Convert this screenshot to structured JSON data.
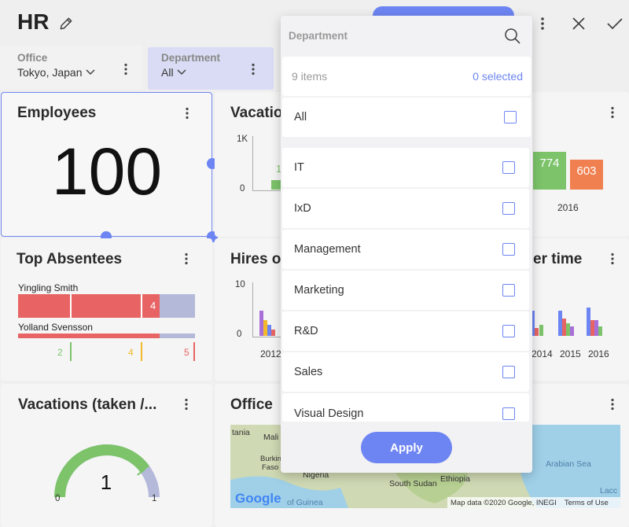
{
  "header": {
    "title": "HR"
  },
  "filters": {
    "office": {
      "label": "Office",
      "value": "Tokyo, Japan"
    },
    "department": {
      "label": "Department",
      "value": "All"
    }
  },
  "cards": {
    "employees": {
      "title": "Employees",
      "value": "100"
    },
    "vacations": {
      "title": "Vacatio",
      "y_ticks": [
        "1K",
        "0"
      ],
      "bar_label_a": "774",
      "bar_label_b": "603",
      "bar_label_partial": "1",
      "year": "2016"
    },
    "top_absentees": {
      "title": "Top Absentees",
      "rows": [
        {
          "name": "Yingling Smith",
          "badge": "4"
        },
        {
          "name": "Yolland Svensson"
        }
      ],
      "markers": [
        "2",
        "4",
        "5"
      ]
    },
    "hires": {
      "title": "Hires ov",
      "y_ticks": [
        "10",
        "0"
      ],
      "x_start": "2012"
    },
    "over_time": {
      "title": "er time",
      "years": [
        "2014",
        "2015",
        "2016"
      ]
    },
    "vacations_taken": {
      "title": "Vacations (taken /...",
      "value": "1",
      "min": "0",
      "max": "1",
      "fill_fraction": 0.8
    },
    "office": {
      "title": "Office",
      "map_labels": [
        "tania",
        "Mali",
        "Burkin",
        "Faso",
        "Nigeria",
        "South Sudan",
        "Ethiopia",
        "Arabian Sea",
        "of Guinea",
        "Lacc"
      ],
      "logo": "Google",
      "attribution": "Map data ©2020 Google, INEGI",
      "terms": "Terms of Use"
    }
  },
  "dropdown": {
    "title": "Department",
    "count_text": "9 items",
    "selected_text": "0 selected",
    "all_label": "All",
    "items": [
      "IT",
      "IxD",
      "Management",
      "Marketing",
      "R&D",
      "Sales",
      "Visual Design"
    ],
    "apply_label": "Apply"
  },
  "colors": {
    "accent": "#6d85f2",
    "red": "#e86464",
    "green": "#7cc36a",
    "orange": "#f08050",
    "purple": "#a96fd8",
    "yellow": "#f2b92a",
    "lavender": "#b4b9da"
  }
}
